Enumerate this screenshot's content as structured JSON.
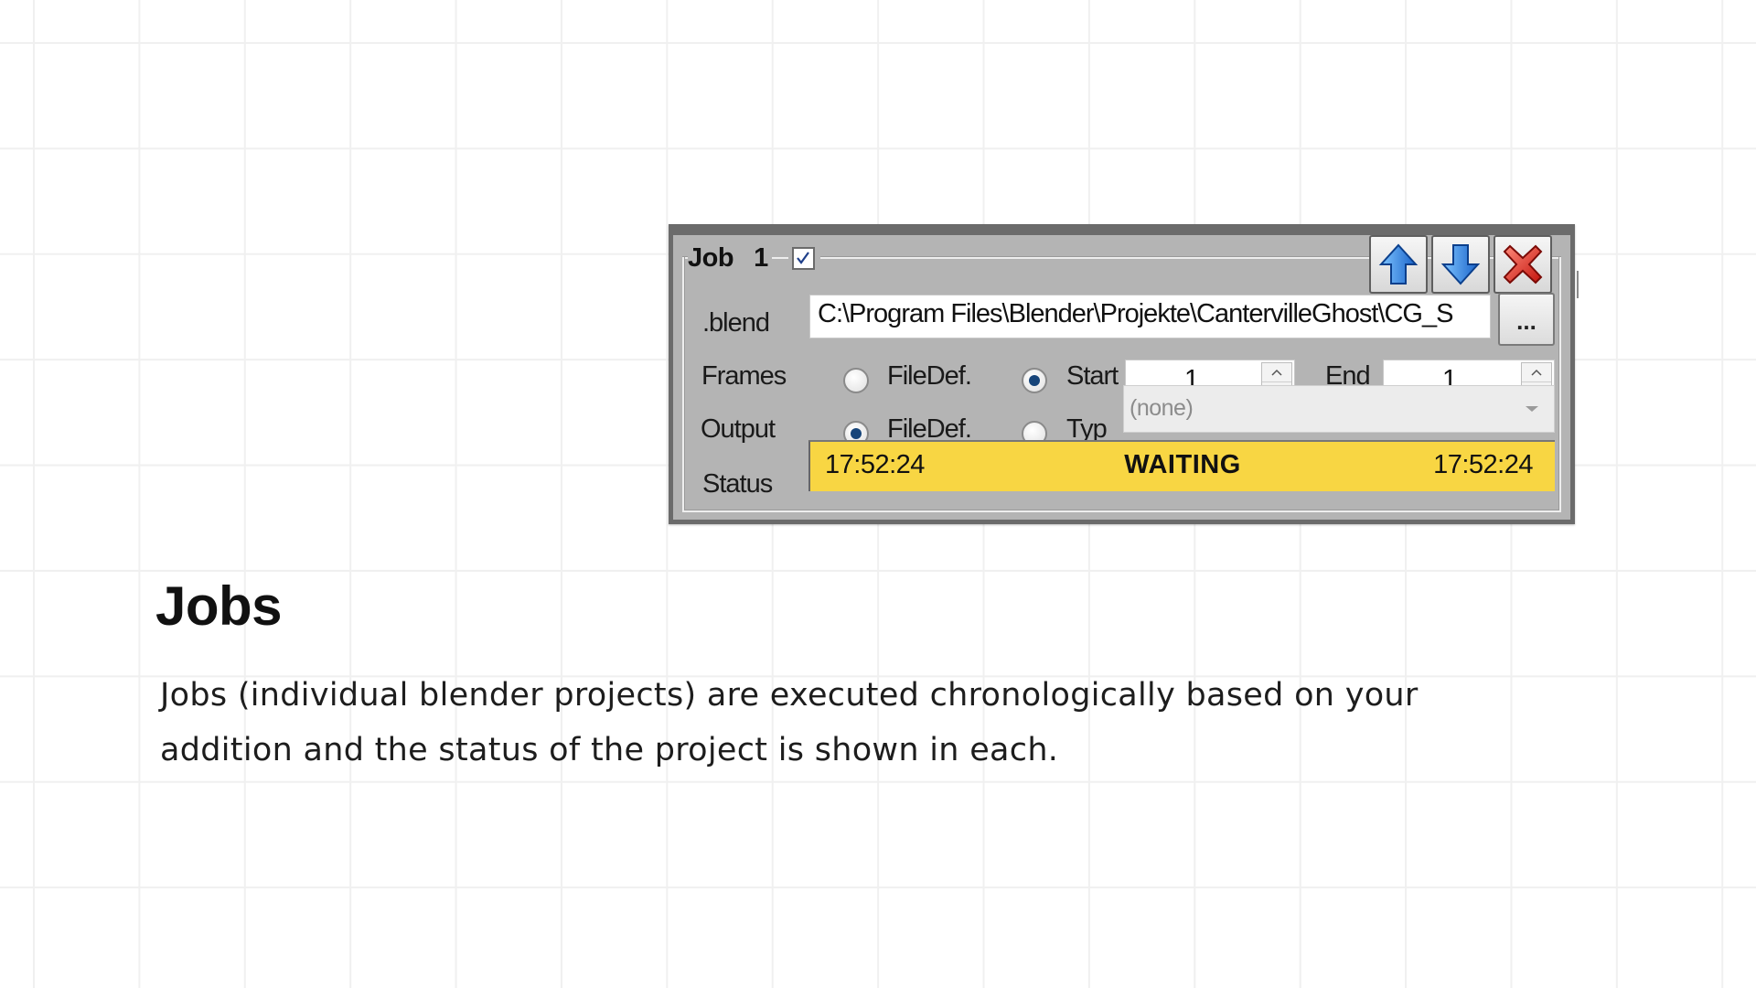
{
  "job_panel": {
    "group_title": "Job",
    "job_number": "1",
    "enabled_checked": true,
    "buttons": {
      "move_up_icon": "arrow-up-icon",
      "move_down_icon": "arrow-down-icon",
      "remove_icon": "red-x-icon"
    },
    "blend": {
      "label": ".blend",
      "path": "C:\\Program Files\\Blender\\Projekte\\CantervilleGhost\\CG_S",
      "browse_label": "..."
    },
    "frames": {
      "label": "Frames",
      "option_filedef": "FileDef.",
      "option_start": "Start",
      "selected": "Start",
      "start_value": "1",
      "end_label": "End",
      "end_value": "1"
    },
    "output": {
      "label": "Output",
      "option_filedef": "FileDef.",
      "option_typ": "Typ",
      "selected": "FileDef.",
      "typ_value": "(none)"
    },
    "status": {
      "label": "Status",
      "time_start": "17:52:24",
      "state": "WAITING",
      "time_end": "17:52:24",
      "color": "#f8d643"
    }
  },
  "slide": {
    "heading": "Jobs",
    "body": "Jobs (individual blender projects) are executed chronologically based on your addition and the status of the project is shown in each."
  }
}
